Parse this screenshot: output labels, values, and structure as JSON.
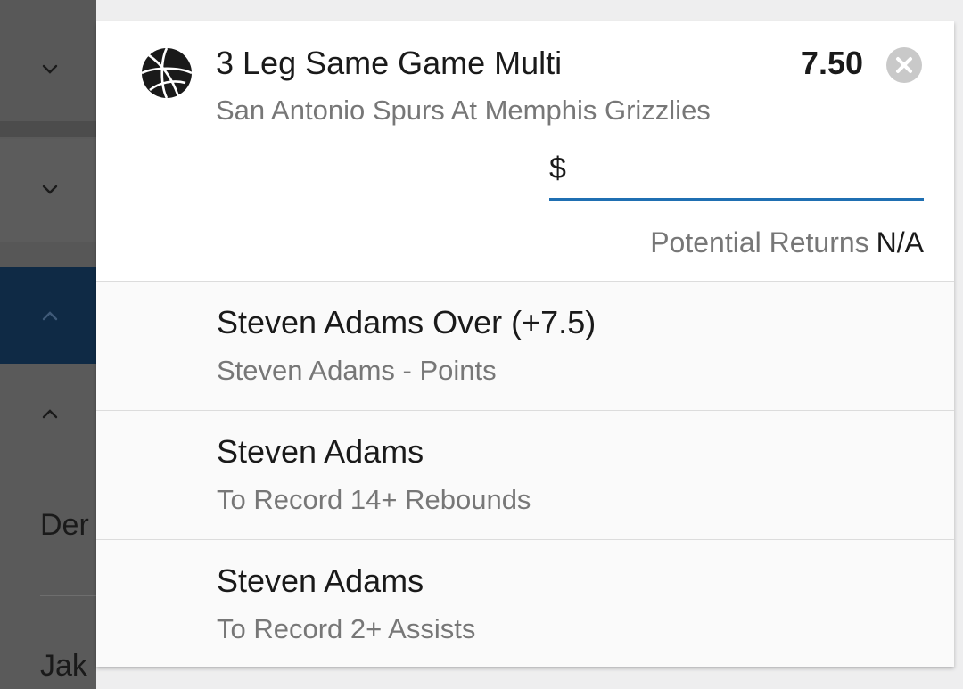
{
  "background": {
    "row_texts": [
      "Der",
      "Jak"
    ]
  },
  "bet": {
    "title": "3 Leg Same Game Multi",
    "event": "San Antonio Spurs At Memphis Grizzlies",
    "odds": "7.50",
    "sport_icon": "basketball-icon",
    "currency": "$",
    "stake_value": "",
    "returns_label": "Potential Returns",
    "returns_value": "N/A",
    "accent_color": "#1f6fb2"
  },
  "legs": [
    {
      "selection": "Steven Adams Over (+7.5)",
      "market": "Steven Adams - Points"
    },
    {
      "selection": "Steven Adams",
      "market": "To Record 14+ Rebounds"
    },
    {
      "selection": "Steven Adams",
      "market": "To Record 2+ Assists"
    }
  ]
}
